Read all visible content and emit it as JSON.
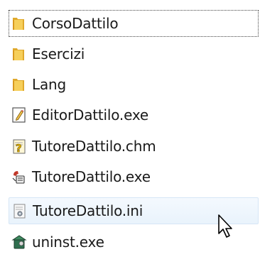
{
  "files": [
    {
      "name": "CorsoDattilo",
      "icon": "folder-icon"
    },
    {
      "name": "Esercizi",
      "icon": "folder-icon"
    },
    {
      "name": "Lang",
      "icon": "folder-icon"
    },
    {
      "name": "EditorDattilo.exe",
      "icon": "editor-exe-icon"
    },
    {
      "name": "TutoreDattilo.chm",
      "icon": "help-file-icon"
    },
    {
      "name": "TutoreDattilo.exe",
      "icon": "app-exe-icon"
    },
    {
      "name": "TutoreDattilo.ini",
      "icon": "settings-file-icon"
    },
    {
      "name": "uninst.exe",
      "icon": "uninstaller-icon"
    }
  ],
  "colors": {
    "folder": "#e8b53c",
    "hover_bg": "#eaf3fd",
    "text": "#1a1a1a"
  }
}
